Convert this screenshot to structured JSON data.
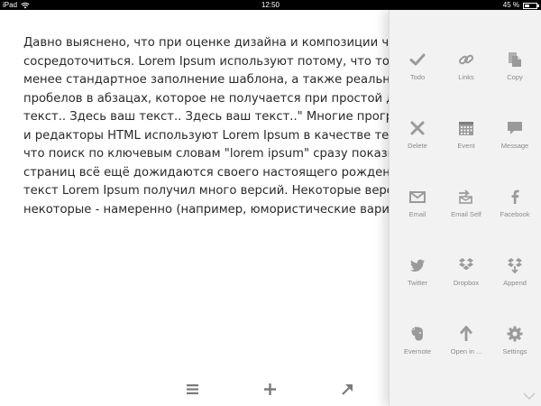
{
  "status_bar": {
    "device": "iPad",
    "time": "12:50",
    "battery_text": "45 %"
  },
  "editor": {
    "lines": [
      "Давно выяснено, что при оценке дизайна и композиции читае",
      "сосредоточиться. Lorem Ipsum используют потому, что тот обе",
      "менее стандартное заполнение шаблона, а также реальное ра",
      "пробелов в абзацах, которое не получается при простой дубл",
      "текст.. Здесь ваш текст.. Здесь ваш текст..\" Многие программы",
      "и редакторы HTML используют Lorem Ipsum в качестве текста",
      "что поиск по ключевым словам \"lorem ipsum\" сразу показыва",
      "страниц всё ещё дожидаются своего настоящего рождения. За",
      "текст Lorem Ipsum получил много версий. Некоторые версии п",
      "некоторые - намеренно (например, юмористические варианты"
    ]
  },
  "toolbar": {
    "icons": [
      "menu-icon",
      "plus-icon",
      "share-arrow-icon"
    ]
  },
  "actions": [
    {
      "id": "todo",
      "label": "Todo",
      "icon": "checkmark-icon"
    },
    {
      "id": "links",
      "label": "Links",
      "icon": "link-icon"
    },
    {
      "id": "copy",
      "label": "Copy",
      "icon": "copy-icon"
    },
    {
      "id": "delete",
      "label": "Delete",
      "icon": "x-icon"
    },
    {
      "id": "event",
      "label": "Event",
      "icon": "calendar-icon"
    },
    {
      "id": "message",
      "label": "Message",
      "icon": "speech-bubble-icon"
    },
    {
      "id": "email",
      "label": "Email",
      "icon": "envelope-icon"
    },
    {
      "id": "email-self",
      "label": "Email Self",
      "icon": "email-self-icon"
    },
    {
      "id": "facebook",
      "label": "Facebook",
      "icon": "facebook-icon"
    },
    {
      "id": "twitter",
      "label": "Twitter",
      "icon": "twitter-bird-icon"
    },
    {
      "id": "dropbox",
      "label": "Dropbox",
      "icon": "dropbox-icon"
    },
    {
      "id": "append",
      "label": "Append",
      "icon": "dropbox-append-icon"
    },
    {
      "id": "evernote",
      "label": "Evernote",
      "icon": "evernote-elephant-icon"
    },
    {
      "id": "open-in",
      "label": "Open in ...",
      "icon": "arrow-up-icon"
    },
    {
      "id": "settings",
      "label": "Settings",
      "icon": "gear-icon"
    }
  ],
  "colors": {
    "icon": "#9a9a9a",
    "label": "#8a8a8a",
    "text": "#2a2a2a",
    "panel_bg": "#f2f2f2",
    "toolbar_icon": "#7a7a7a"
  }
}
